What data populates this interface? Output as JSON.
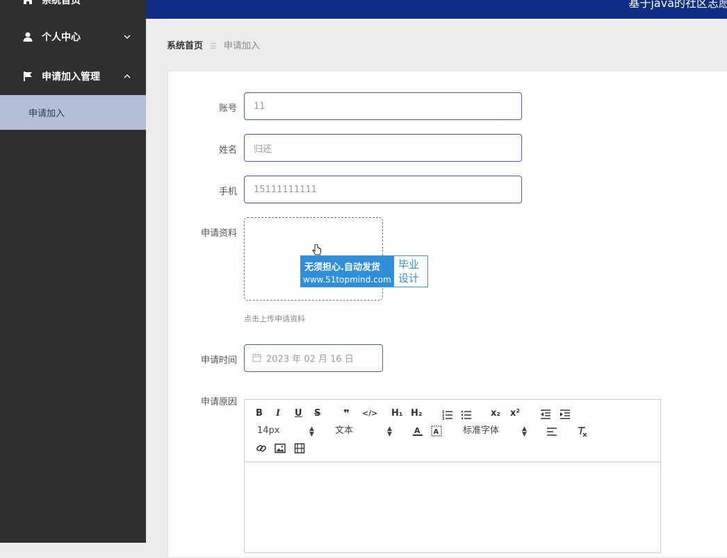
{
  "sidebar": {
    "items": [
      {
        "label": "系统首页",
        "icon": "home-icon"
      },
      {
        "label": "个人中心",
        "icon": "user-icon"
      },
      {
        "label": "申请加入管理",
        "icon": "flag-icon"
      }
    ],
    "sub_item": "申请加入"
  },
  "header": {
    "title": "基于java的社区志愿者"
  },
  "breadcrumb": {
    "home": "系统首页",
    "current": "申请加入"
  },
  "form": {
    "account": {
      "label": "账号",
      "value": "11"
    },
    "name": {
      "label": "姓名",
      "value": "归还"
    },
    "phone": {
      "label": "手机",
      "value": "15111111111"
    },
    "material": {
      "label": "申请资料",
      "tip": "点击上传申请资料"
    },
    "time": {
      "label": "申请时间",
      "value": "2023 年 02 月 16 日"
    },
    "reason": {
      "label": "申请原因"
    }
  },
  "editor": {
    "font_size": "14px",
    "text_type": "文本",
    "font_family": "标准字体",
    "buttons": {
      "bold": "B",
      "italic": "I",
      "underline": "U",
      "strike": "S",
      "quote": "❞",
      "code": "</>",
      "h1": "H₁",
      "h2": "H₂",
      "subscript": "x₂",
      "superscript": "x²"
    }
  },
  "watermark": {
    "line1": "无须担心.自动发货",
    "line2": "www.51topmind.com",
    "right": "毕业设计"
  },
  "colors": {
    "sidebar": "#2f2f2f",
    "header": "#0f2d84",
    "accent": "#3d62b4",
    "active_sub": "#b4bdd6"
  }
}
